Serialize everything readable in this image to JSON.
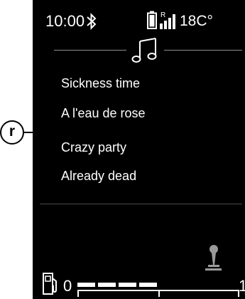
{
  "status_bar": {
    "time": "10:00",
    "bluetooth_icon": "bluetooth-icon",
    "battery_icon": "phone-battery-icon",
    "signal_icon": "roaming-signal-icon",
    "signal_roaming_label": "R",
    "temperature": "18C°"
  },
  "header": {
    "icon": "music-note-icon"
  },
  "tracks": [
    "Sickness time",
    "A l'eau de rose",
    "Crazy party",
    "Already dead"
  ],
  "callout": {
    "label": "r"
  },
  "bottom": {
    "gear_icon": "gear-lever-icon",
    "fuel_icon": "fuel-pump-icon",
    "fuel_empty_label": "0",
    "fuel_full_label": "1",
    "fuel_level": 0.45
  },
  "colors": {
    "screen_background": "#000000",
    "text": "#ffffff",
    "divider": "#8e8e8e",
    "gauge_segment": "#ffffff"
  }
}
